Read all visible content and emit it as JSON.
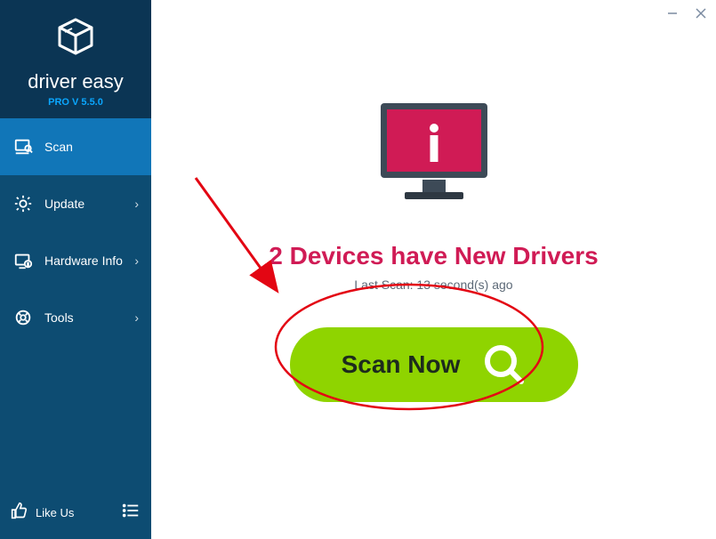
{
  "brand": {
    "name": "driver easy",
    "version": "PRO V 5.5.0"
  },
  "sidebar": {
    "items": [
      {
        "label": "Scan",
        "has_chevron": false
      },
      {
        "label": "Update",
        "has_chevron": true
      },
      {
        "label": "Hardware Info",
        "has_chevron": true
      },
      {
        "label": "Tools",
        "has_chevron": true
      }
    ],
    "like_label": "Like Us"
  },
  "main": {
    "headline": "2 Devices have New Drivers",
    "last_scan": "Last Scan: 13 second(s) ago",
    "scan_button": "Scan Now"
  },
  "colors": {
    "sidebar_dark": "#0b3554",
    "sidebar": "#0d4c72",
    "active": "#1176b8",
    "accent_pink": "#d01b55",
    "scan_green": "#8fd400"
  }
}
